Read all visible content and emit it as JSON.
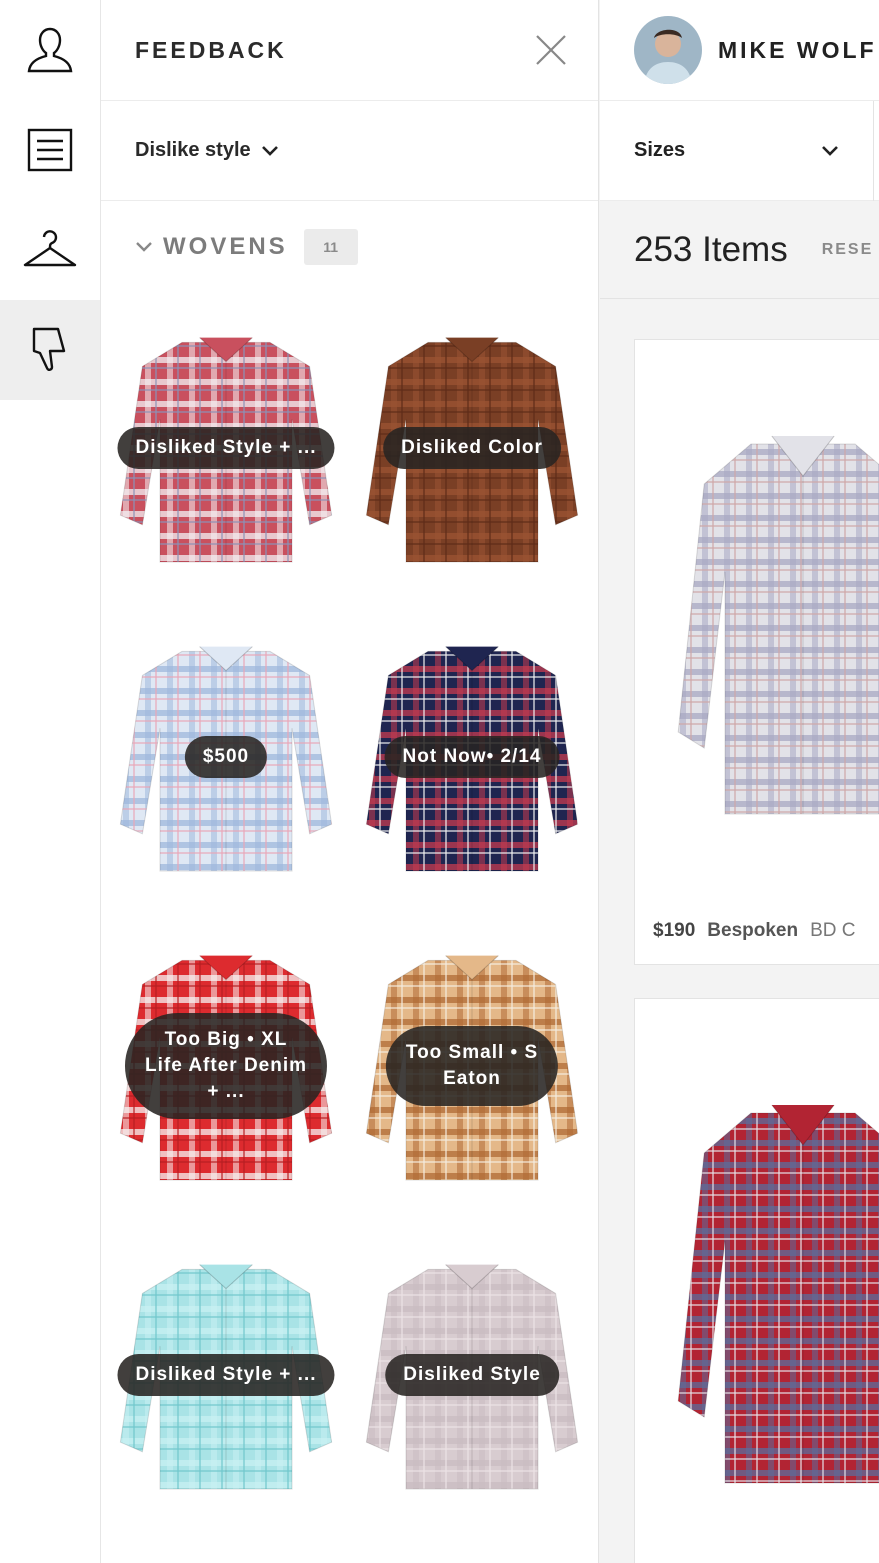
{
  "rail": {
    "items": [
      {
        "name": "profile",
        "icon": "person-icon",
        "active": false
      },
      {
        "name": "notes",
        "icon": "document-icon",
        "active": false
      },
      {
        "name": "closet",
        "icon": "hanger-icon",
        "active": false
      },
      {
        "name": "feedback",
        "icon": "thumbs-down-icon",
        "active": true
      }
    ]
  },
  "panel": {
    "title": "FEEDBACK",
    "filter_label": "Dislike style",
    "section": {
      "title": "WOVENS",
      "count": "11"
    },
    "items": [
      {
        "tag": "Disliked Style + ...",
        "colors": [
          "#c9505e",
          "#f3f0f2",
          "#8a92b8"
        ]
      },
      {
        "tag": "Disliked Color",
        "colors": [
          "#7a3f25",
          "#9a5332",
          "#5e2c18"
        ]
      },
      {
        "tag": "$500",
        "colors": [
          "#dfe8f4",
          "#9fb8dc",
          "#e9a7b7"
        ]
      },
      {
        "tag": "Not Now• 2/14",
        "colors": [
          "#1f2550",
          "#c43b4f",
          "#f2f2f2"
        ]
      },
      {
        "tag": "Too Big • XL\nLife After Denim\n+ ...",
        "colors": [
          "#dd2b2f",
          "#f6f1f1",
          "#b81e22"
        ]
      },
      {
        "tag": "Too Small • S\nEaton",
        "colors": [
          "#e4b889",
          "#b06a35",
          "#f5ecdf"
        ]
      },
      {
        "tag": "Disliked Style + ...",
        "colors": [
          "#a9e3e6",
          "#c8f0f1",
          "#6fc7cc"
        ]
      },
      {
        "tag": "Disliked Style",
        "colors": [
          "#d8ccd0",
          "#c9bcc1",
          "#ece3e6"
        ]
      }
    ]
  },
  "main": {
    "user_name": "MIKE WOLF",
    "sizes_label": "Sizes",
    "item_count": "253 Items",
    "reset_label": "RESE",
    "products": [
      {
        "price": "$190",
        "brand": "Bespoken",
        "name": "BD C",
        "colors": [
          "#e2e2e8",
          "#a8a8c2",
          "#cfa6a6"
        ]
      },
      {
        "price": "",
        "brand": "",
        "name": "",
        "colors": [
          "#b22433",
          "#5b6c9a",
          "#e6e3ea"
        ]
      }
    ]
  }
}
